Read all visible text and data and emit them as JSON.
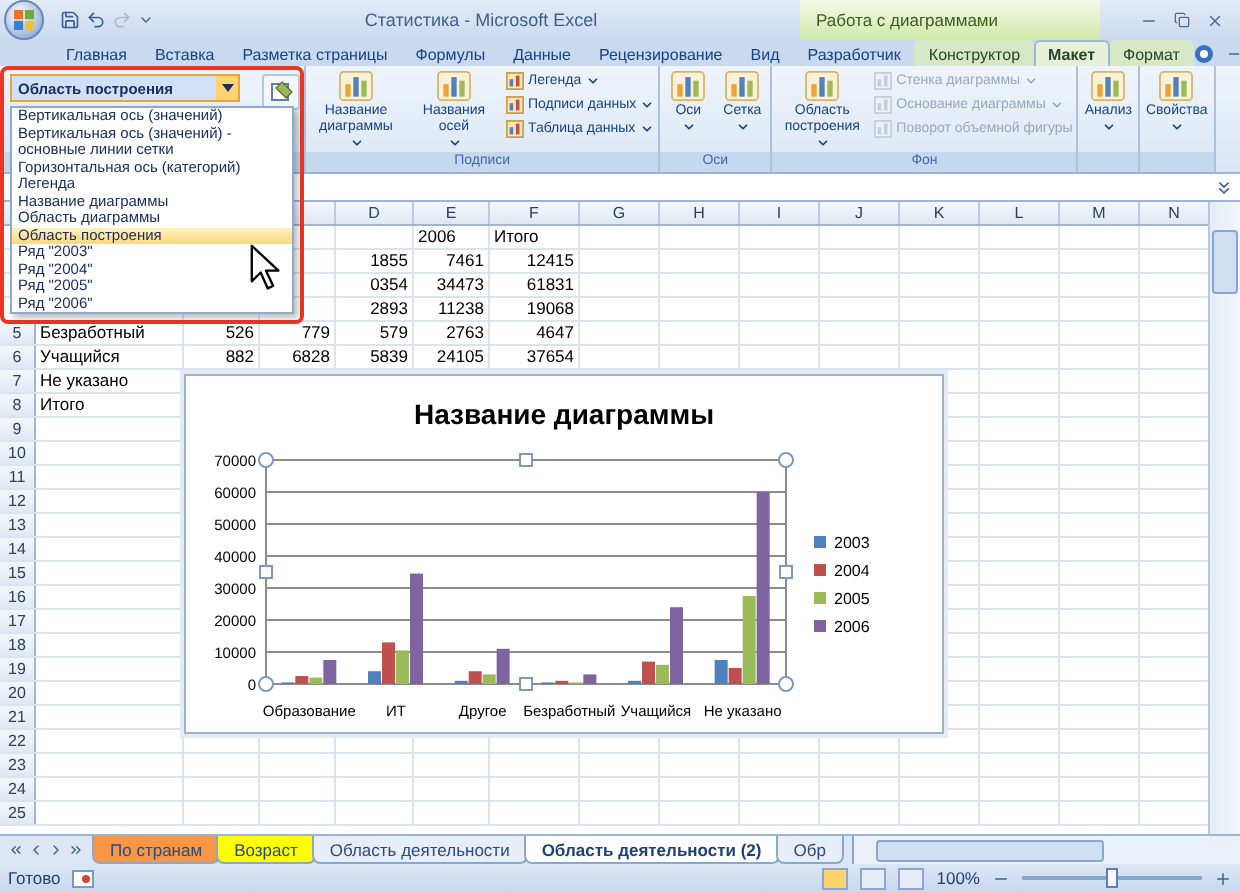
{
  "window": {
    "title": "Статистика - Microsoft Excel",
    "context_title": "Работа с диаграммами"
  },
  "ribbon_tabs": [
    {
      "label": "Главная",
      "selected": false,
      "contextual": false
    },
    {
      "label": "Вставка",
      "selected": false,
      "contextual": false
    },
    {
      "label": "Разметка страницы",
      "selected": false,
      "contextual": false
    },
    {
      "label": "Формулы",
      "selected": false,
      "contextual": false
    },
    {
      "label": "Данные",
      "selected": false,
      "contextual": false
    },
    {
      "label": "Рецензирование",
      "selected": false,
      "contextual": false
    },
    {
      "label": "Вид",
      "selected": false,
      "contextual": false
    },
    {
      "label": "Разработчик",
      "selected": false,
      "contextual": false
    },
    {
      "label": "Конструктор",
      "selected": false,
      "contextual": true
    },
    {
      "label": "Макет",
      "selected": true,
      "contextual": true
    },
    {
      "label": "Формат",
      "selected": false,
      "contextual": true
    }
  ],
  "selection": {
    "value": "Область построения",
    "expanded": true,
    "options": [
      {
        "label": "Вертикальная ось (значений)",
        "selected": false
      },
      {
        "label": "Вертикальная ось (значений) - основные линии сетки",
        "selected": false
      },
      {
        "label": "Горизонтальная ось (категорий)",
        "selected": false
      },
      {
        "label": "Легенда",
        "selected": false
      },
      {
        "label": "Название диаграммы",
        "selected": false
      },
      {
        "label": "Область диаграммы",
        "selected": false
      },
      {
        "label": "Область построения",
        "selected": true
      },
      {
        "label": "Ряд \"2003\"",
        "selected": false
      },
      {
        "label": "Ряд \"2004\"",
        "selected": false
      },
      {
        "label": "Ряд \"2005\"",
        "selected": false
      },
      {
        "label": "Ряд \"2006\"",
        "selected": false
      }
    ]
  },
  "ribbon_groups": [
    {
      "label": "Подписи",
      "items": [
        {
          "kind": "large",
          "label": "Название диаграммы",
          "dropdown": true,
          "disabled": false
        },
        {
          "kind": "large",
          "label": "Названия осей",
          "dropdown": true,
          "disabled": false
        },
        {
          "kind": "small",
          "label": "Легенда",
          "dropdown": true,
          "disabled": false
        },
        {
          "kind": "small",
          "label": "Подписи данных",
          "dropdown": true,
          "disabled": false
        },
        {
          "kind": "small",
          "label": "Таблица данных",
          "dropdown": true,
          "disabled": false
        }
      ]
    },
    {
      "label": "Оси",
      "items": [
        {
          "kind": "large",
          "label": "Оси",
          "dropdown": true,
          "disabled": false
        },
        {
          "kind": "large",
          "label": "Сетка",
          "dropdown": true,
          "disabled": false
        }
      ]
    },
    {
      "label": "Фон",
      "items": [
        {
          "kind": "large",
          "label": "Область построения",
          "dropdown": true,
          "disabled": false
        },
        {
          "kind": "small",
          "label": "Стенка диаграммы",
          "dropdown": true,
          "disabled": true
        },
        {
          "kind": "small",
          "label": "Основание диаграммы",
          "dropdown": true,
          "disabled": true
        },
        {
          "kind": "small",
          "label": "Поворот объемной фигуры",
          "dropdown": false,
          "disabled": true
        }
      ]
    },
    {
      "items": [
        {
          "kind": "large",
          "label": "Анализ",
          "dropdown": true,
          "disabled": false
        }
      ]
    },
    {
      "items": [
        {
          "kind": "large",
          "label": "Свойства",
          "dropdown": true,
          "disabled": false
        }
      ]
    }
  ],
  "sheet": {
    "columns": [
      null,
      null,
      null,
      "D",
      "E",
      "F",
      "G",
      "H",
      "I",
      "J",
      "K",
      "L",
      "M",
      "N"
    ],
    "rows": [
      {
        "kind": "header",
        "cells": [
          null,
          null,
          null,
          null,
          "2006",
          "Итого"
        ]
      },
      {
        "kind": "data",
        "cells": [
          null,
          null,
          null,
          "1855",
          "7461",
          "12415"
        ]
      },
      {
        "kind": "data",
        "cells": [
          null,
          null,
          null,
          "0354",
          "34473",
          "61831"
        ]
      },
      {
        "kind": "data",
        "cells": [
          null,
          null,
          null,
          "2893",
          "11238",
          "19068"
        ]
      },
      {
        "number": "5",
        "kind": "data",
        "cells": [
          "Безработный",
          "526",
          "779",
          "579",
          "2763",
          "4647"
        ]
      },
      {
        "number": "6",
        "kind": "data",
        "cells": [
          "Учащийся",
          "882",
          "6828",
          "5839",
          "24105",
          "37654"
        ]
      },
      {
        "number": "7",
        "kind": "data",
        "cells": [
          "Не указано"
        ]
      },
      {
        "number": "8",
        "kind": "data",
        "cells": [
          "Итого"
        ]
      },
      {
        "number": "9"
      },
      {
        "number": "10"
      },
      {
        "number": "11"
      },
      {
        "number": "12"
      },
      {
        "number": "13"
      },
      {
        "number": "14"
      },
      {
        "number": "15"
      },
      {
        "number": "16"
      },
      {
        "number": "17"
      },
      {
        "number": "18"
      },
      {
        "number": "19"
      },
      {
        "number": "20"
      },
      {
        "number": "21"
      },
      {
        "number": "22"
      },
      {
        "number": "23"
      },
      {
        "number": "24"
      },
      {
        "number": "25"
      }
    ],
    "chart": {
      "chart_data": {
        "type": "bar",
        "title": "Название диаграммы",
        "categories": [
          "Образование",
          "ИТ",
          "Другое",
          "Безработный",
          "Учащийся",
          "Не указано"
        ],
        "series": [
          {
            "name": "2003",
            "color": "#4f81bd",
            "values": [
              500,
              4000,
              1000,
              500,
              1000,
              7500
            ]
          },
          {
            "name": "2004",
            "color": "#c0504d",
            "values": [
              2500,
              13000,
              4000,
              1000,
              7000,
              5000
            ]
          },
          {
            "name": "2005",
            "color": "#9bbb59",
            "values": [
              2000,
              10500,
              3000,
              500,
              6000,
              27500
            ]
          },
          {
            "name": "2006",
            "color": "#8064a2",
            "values": [
              7500,
              34500,
              11000,
              3000,
              24000,
              60000
            ]
          }
        ],
        "ylim": [
          0,
          70000
        ],
        "yticks": [
          0,
          10000,
          20000,
          30000,
          40000,
          50000,
          60000,
          70000
        ],
        "grid": true,
        "legend": true
      }
    },
    "tabs": [
      {
        "label": "По странам",
        "selected": false,
        "color": "#f79646"
      },
      {
        "label": "Возраст",
        "selected": false,
        "color": "#ffff00"
      },
      {
        "label": "Область деятельности",
        "selected": false
      },
      {
        "label": "Область деятельности (2)",
        "selected": true
      },
      {
        "label": "Обр",
        "selected": false
      }
    ]
  },
  "status_bar": {
    "text": "Готово",
    "views": [
      {
        "selected": true
      },
      {
        "selected": false
      },
      {
        "selected": false
      }
    ],
    "zoom": "100%",
    "zoom_slider": {
      "level": 0.5
    }
  }
}
